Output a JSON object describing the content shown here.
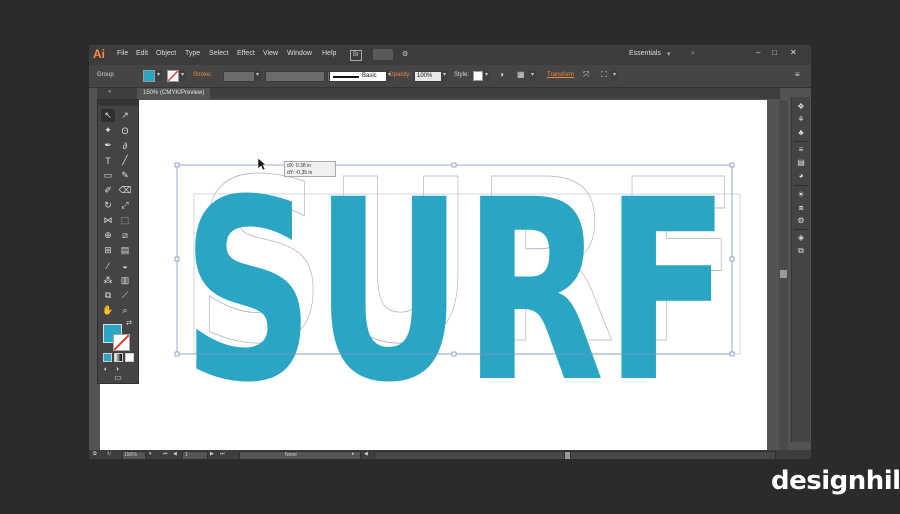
{
  "app": {
    "logo": "Ai",
    "workspace": "Essentials"
  },
  "menu": [
    "File",
    "Edit",
    "Object",
    "Type",
    "Select",
    "Effect",
    "View",
    "Window",
    "Help"
  ],
  "bridge": "Br",
  "window_controls": {
    "minimize": "–",
    "maximize": "□",
    "close": "✕"
  },
  "control_bar": {
    "selection": "Group",
    "stroke_label": "Stroke:",
    "brush": "Basic",
    "opacity_label": "Opacity:",
    "opacity_value": "100%",
    "style_label": "Style:",
    "transform_label": "Transform",
    "fill_color": "#2aa6c4",
    "stroke_color": "none"
  },
  "document": {
    "tab_title": "150% (CMYK/Preview)",
    "tab_close": "«"
  },
  "canvas": {
    "text": "SURF",
    "fill_color": "#2aa6c4",
    "ghost_text": "SURF",
    "tooltip_dx": "dX: 0.38 in",
    "tooltip_dy": "dY: -0.35 in"
  },
  "status": {
    "zoom": "150%",
    "page": "1",
    "mode": "None"
  },
  "watermark": "designhill",
  "colors": {
    "fill": "#2aa6c4",
    "bg": "#2b2b2b",
    "artboard": "#ffffff"
  }
}
